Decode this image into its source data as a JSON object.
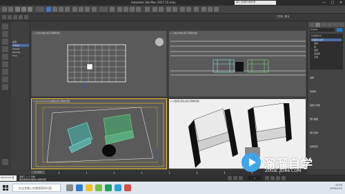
{
  "window": {
    "title": "Autodesk 3ds Max 2017    15.max",
    "search_placeholder": "键入关键字或短语",
    "minimize": "—",
    "maximize": "□",
    "close": "✕"
  },
  "ribbon": {
    "workspace_label": "工作区: 默认"
  },
  "scene_explorer": {
    "items": [
      "名称",
      "Sofa01",
      "Sofa02",
      "Table01",
      "Floor"
    ]
  },
  "viewports": {
    "top_label": "[+][顶][线框][默认明暗处理]",
    "front_label": "[+][前][线框][默认明暗处理]",
    "left_label": "[+][Camera001][线框][默认明暗处理]",
    "persp_label": "[+][透视][真实][默认明暗处理]"
  },
  "command_panel": {
    "object_name": "Sofa01",
    "modifier_list_label": "修改器列表",
    "modifiers": [
      "可编辑多边形",
      "顶点",
      "边",
      "边界",
      "多边形",
      "元素"
    ],
    "sections": [
      "选择",
      "软选择",
      "编辑几何体",
      "细分曲面",
      "细分置换",
      "绘制变形"
    ]
  },
  "timeline": {
    "frame_label": "0 / 100"
  },
  "status": {
    "script_label": "MAXScript 迷",
    "message_line1": "选择了 1 个 对象",
    "message_line2": "单击或单击并拖动以选择对象",
    "frame_value": "0"
  },
  "taskbar": {
    "search_placeholder": "在这里输入你要搜索的内容",
    "time": "10:45",
    "date": "2020/1/10"
  },
  "watermark": {
    "name": "溜溜自学",
    "url": "ZIXUE.3D66.COM"
  },
  "colors": {
    "accent": "#1f7fd6",
    "selection_yellow": "#f2c02a",
    "wire_cyan": "#7ff5f0",
    "wire_green": "#7fe07a"
  }
}
